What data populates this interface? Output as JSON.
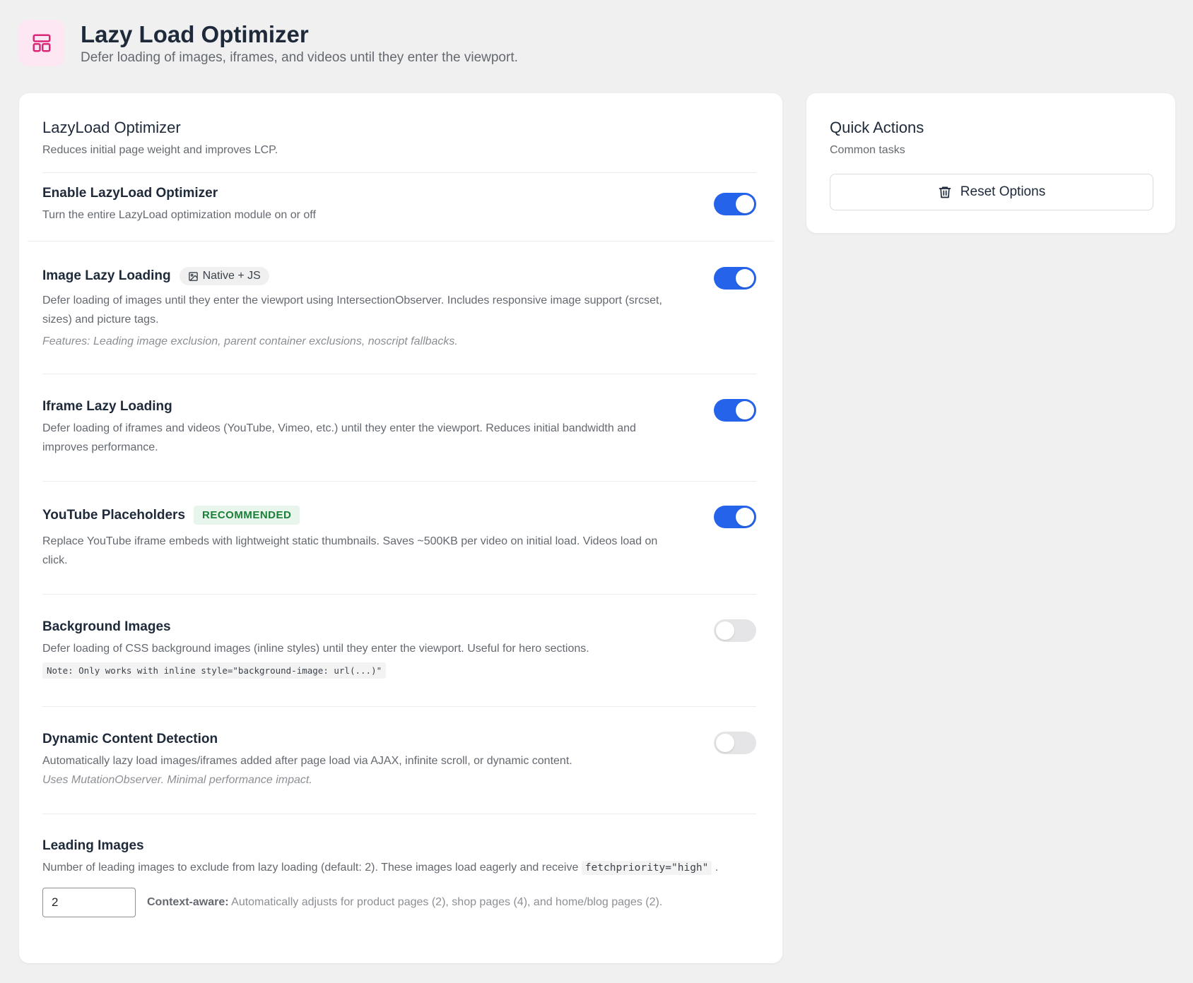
{
  "header": {
    "title": "Lazy Load Optimizer",
    "subtitle": "Defer loading of images, iframes, and videos until they enter the viewport.",
    "icon": "layout-icon",
    "icon_color": "#db2777",
    "icon_bg": "#fce7f3"
  },
  "main": {
    "title": "LazyLoad Optimizer",
    "subtitle": "Reduces initial page weight and improves LCP.",
    "settings": [
      {
        "title": "Enable LazyLoad Optimizer",
        "desc": "Turn the entire LazyLoad optimization module on or off",
        "enabled": true
      },
      {
        "title": "Image Lazy Loading",
        "badge": "Native + JS",
        "desc": "Defer loading of images until they enter the viewport using IntersectionObserver. Includes responsive image support (srcset, sizes) and picture tags.",
        "note": "Features: Leading image exclusion, parent container exclusions, noscript fallbacks.",
        "enabled": true
      },
      {
        "title": "Iframe Lazy Loading",
        "desc": "Defer loading of iframes and videos (YouTube, Vimeo, etc.) until they enter the viewport. Reduces initial bandwidth and improves performance.",
        "enabled": true
      },
      {
        "title": "YouTube Placeholders",
        "badge": "RECOMMENDED",
        "desc": "Replace YouTube iframe embeds with lightweight static thumbnails. Saves ~500KB per video on initial load. Videos load on click.",
        "enabled": true
      },
      {
        "title": "Background Images",
        "desc": "Defer loading of CSS background images (inline styles) until they enter the viewport. Useful for hero sections.",
        "code_note": "Note: Only works with inline style=\"background-image: url(...)\"",
        "enabled": false
      },
      {
        "title": "Dynamic Content Detection",
        "desc": "Automatically lazy load images/iframes added after page load via AJAX, infinite scroll, or dynamic content.",
        "note": "Uses MutationObserver. Minimal performance impact.",
        "enabled": false
      }
    ],
    "leading": {
      "title": "Leading Images",
      "desc_prefix": "Number of leading images to exclude from lazy loading (default: 2). These images load eagerly and receive",
      "code": "fetchpriority=\"high\"",
      "desc_suffix": ".",
      "value": "2",
      "ctx_label": "Context-aware:",
      "ctx_text": "Automatically adjusts for product pages (2), shop pages (4), and home/blog pages (2)."
    }
  },
  "side": {
    "title": "Quick Actions",
    "subtitle": "Common tasks",
    "reset_label": "Reset Options",
    "reset_icon": "trash-icon"
  },
  "colors": {
    "toggle_on": "#2563eb",
    "toggle_off": "#e5e5e7",
    "badge_green_text": "#1a7f37"
  }
}
